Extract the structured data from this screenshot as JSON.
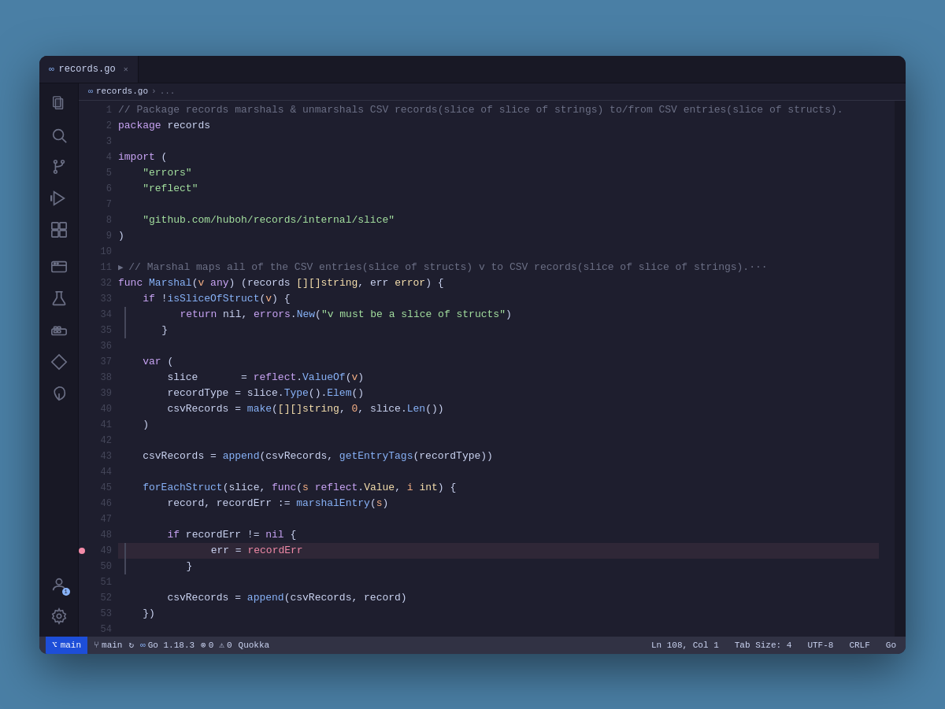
{
  "window": {
    "title": "records.go",
    "background": "#4a7fa5"
  },
  "tabs": [
    {
      "label": "records.go",
      "icon": "go-icon",
      "active": true
    }
  ],
  "breadcrumb": {
    "parts": [
      "records.go",
      ">",
      "..."
    ]
  },
  "activity_bar": {
    "items": [
      {
        "name": "files-icon",
        "symbol": "⧉",
        "active": false
      },
      {
        "name": "search-icon",
        "symbol": "🔍",
        "active": false
      },
      {
        "name": "source-control-icon",
        "symbol": "⑂",
        "active": false
      },
      {
        "name": "run-debug-icon",
        "symbol": "▷",
        "active": false
      },
      {
        "name": "extensions-icon",
        "symbol": "⊞",
        "active": false
      },
      {
        "name": "remote-explorer-icon",
        "symbol": "🖥",
        "active": false
      },
      {
        "name": "testing-icon",
        "symbol": "⚗",
        "active": false
      },
      {
        "name": "docker-icon",
        "symbol": "🐳",
        "active": false
      },
      {
        "name": "gitlense-icon",
        "symbol": "◇",
        "active": false
      },
      {
        "name": "leaf-icon",
        "symbol": "🌿",
        "active": false
      }
    ],
    "bottom": [
      {
        "name": "account-icon",
        "symbol": "👤",
        "badge": "1"
      },
      {
        "name": "settings-icon",
        "symbol": "⚙"
      }
    ]
  },
  "code": {
    "lines": [
      {
        "num": 1,
        "content": "comment",
        "text": "// Package records marshals & unmarshals CSV records(slice of slice of strings) to/from CSV entries(slice of structs)."
      },
      {
        "num": 2,
        "content": "pkg",
        "text": "package records"
      },
      {
        "num": 3,
        "content": "empty",
        "text": ""
      },
      {
        "num": 4,
        "content": "import_kw",
        "text": "import ("
      },
      {
        "num": 5,
        "content": "import_str",
        "text": "    \"errors\""
      },
      {
        "num": 6,
        "content": "import_str",
        "text": "    \"reflect\""
      },
      {
        "num": 7,
        "content": "empty",
        "text": ""
      },
      {
        "num": 8,
        "content": "import_str",
        "text": "    \"github.com/huboh/records/internal/slice\""
      },
      {
        "num": 9,
        "content": "import_close",
        "text": ")"
      },
      {
        "num": 10,
        "content": "empty",
        "text": ""
      },
      {
        "num": 11,
        "content": "collapsed_comment",
        "text": "▶ // Marshal maps all of the CSV entries(slice of structs) v to CSV records(slice of slice of strings).···"
      },
      {
        "num": 32,
        "content": "func_decl",
        "text": "func Marshal(v any) (records [][]string, err error) {"
      },
      {
        "num": 33,
        "content": "if_stmt",
        "text": "    if !isSliceOfStruct(v) {"
      },
      {
        "num": 34,
        "content": "return_stmt",
        "text": "        return nil, errors.New(\"v must be a slice of structs\")"
      },
      {
        "num": 35,
        "content": "close_brace",
        "text": "    }"
      },
      {
        "num": 36,
        "content": "empty",
        "text": ""
      },
      {
        "num": 37,
        "content": "var_decl",
        "text": "    var ("
      },
      {
        "num": 38,
        "content": "var_assign",
        "text": "        slice       = reflect.ValueOf(v)"
      },
      {
        "num": 39,
        "content": "var_assign2",
        "text": "        recordType = slice.Type().Elem()"
      },
      {
        "num": 40,
        "content": "var_assign3",
        "text": "        csvRecords = make([][]string, 0, slice.Len())"
      },
      {
        "num": 41,
        "content": "var_close",
        "text": "    )"
      },
      {
        "num": 42,
        "content": "empty",
        "text": ""
      },
      {
        "num": 43,
        "content": "assign_stmt",
        "text": "    csvRecords = append(csvRecords, getEntryTags(recordType))"
      },
      {
        "num": 44,
        "content": "empty",
        "text": ""
      },
      {
        "num": 45,
        "content": "foreach_stmt",
        "text": "    forEachStruct(slice, func(s reflect.Value, i int) {"
      },
      {
        "num": 46,
        "content": "assign_stmt2",
        "text": "        record, recordErr := marshalEntry(s)"
      },
      {
        "num": 47,
        "content": "empty",
        "text": ""
      },
      {
        "num": 48,
        "content": "if_stmt2",
        "text": "        if recordErr != nil {"
      },
      {
        "num": 49,
        "content": "assign_err",
        "text": "            err = recordErr",
        "breakpoint": true
      },
      {
        "num": 50,
        "content": "close_brace2",
        "text": "        }"
      },
      {
        "num": 51,
        "content": "empty",
        "text": ""
      },
      {
        "num": 52,
        "content": "assign_stmt3",
        "text": "        csvRecords = append(csvRecords, record)"
      },
      {
        "num": 53,
        "content": "close_brace3",
        "text": "    })"
      },
      {
        "num": 54,
        "content": "empty",
        "text": ""
      }
    ]
  },
  "status_bar": {
    "git_branch": "main",
    "go_version": "Go 1.18.3",
    "errors": "0",
    "warnings": "0",
    "extension": "Quokka",
    "position": "Ln 108, Col 1",
    "tab_size": "Tab Size: 4",
    "encoding": "UTF-8",
    "line_ending": "CRLF",
    "language": "Go",
    "remote_label": "main"
  }
}
